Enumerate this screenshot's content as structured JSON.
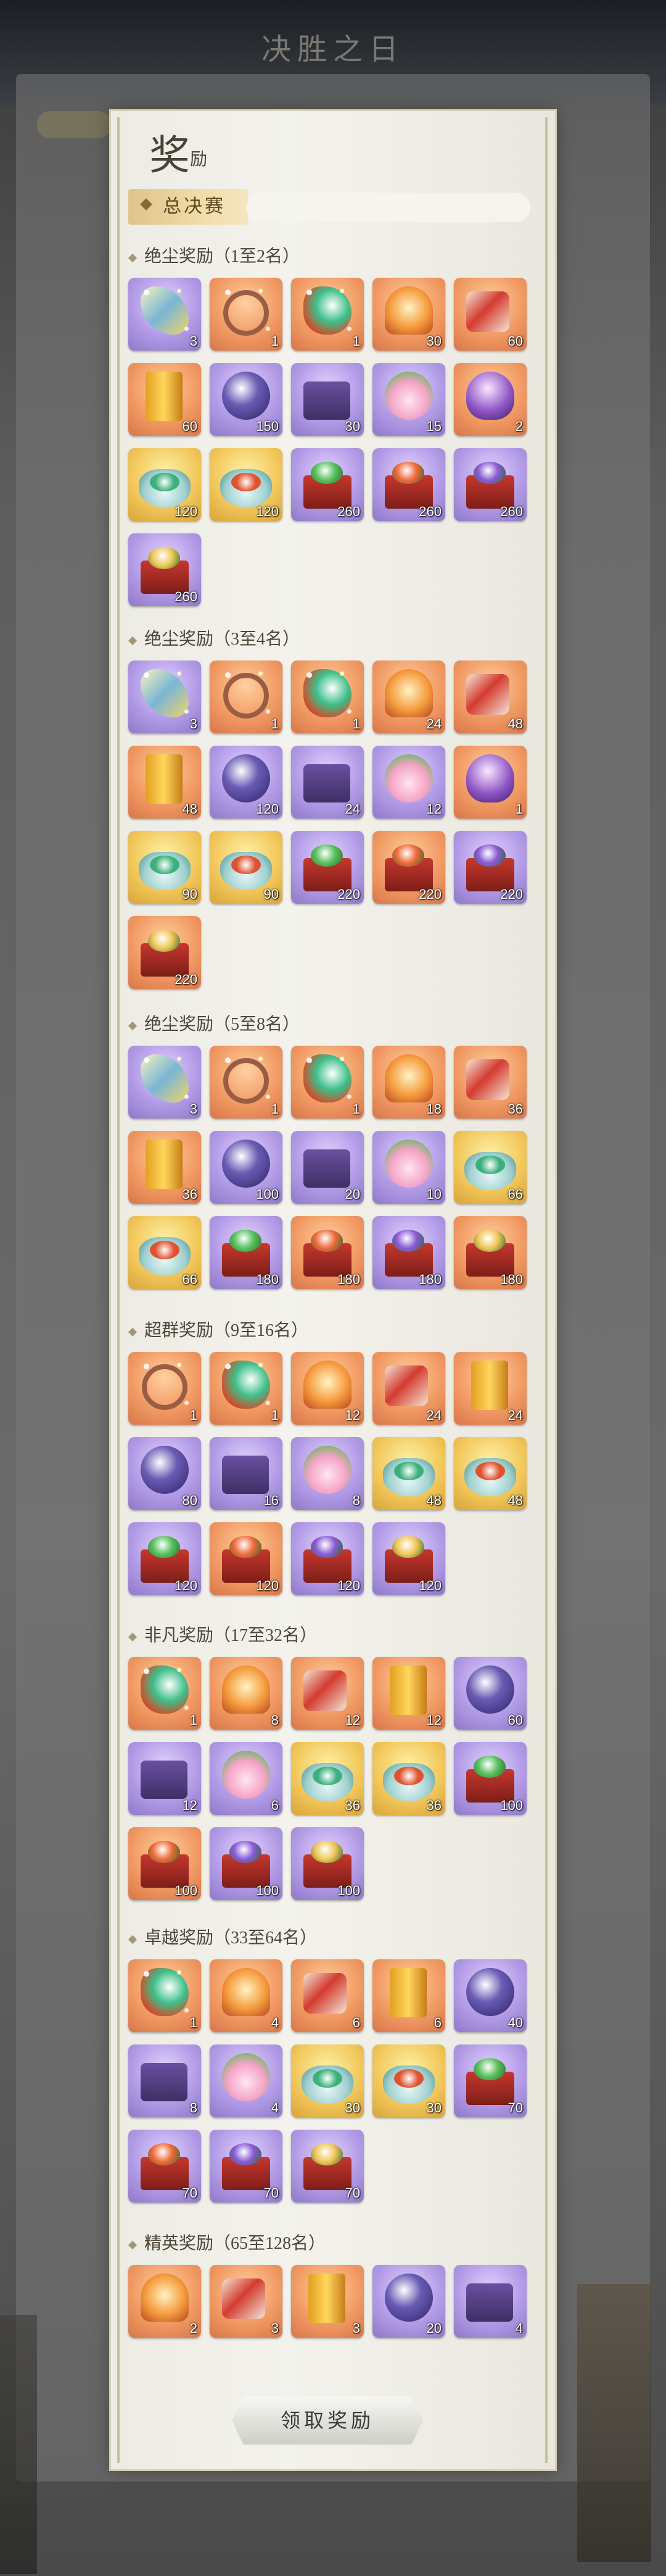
{
  "header": {
    "title": "决胜之日"
  },
  "panel": {
    "title_main": "奖",
    "title_sub": "励",
    "tab_label": "总决赛"
  },
  "sections": [
    {
      "title": "绝尘奖励（1至2名）",
      "items": [
        {
          "icon": "charm",
          "bg": "purple",
          "qty": "3",
          "sparkle": true
        },
        {
          "icon": "ring",
          "bg": "orange",
          "qty": "1",
          "sparkle": true
        },
        {
          "icon": "worm",
          "bg": "orange",
          "qty": "1",
          "sparkle": true
        },
        {
          "icon": "lamp",
          "bg": "orange",
          "qty": "30"
        },
        {
          "icon": "scroll",
          "bg": "orange",
          "qty": "60"
        },
        {
          "icon": "book",
          "bg": "orange",
          "qty": "60"
        },
        {
          "icon": "orb",
          "bg": "purple",
          "qty": "150"
        },
        {
          "icon": "box",
          "bg": "purple",
          "qty": "30"
        },
        {
          "icon": "lotus",
          "bg": "purple",
          "qty": "15"
        },
        {
          "icon": "vase",
          "bg": "orange",
          "qty": "2"
        },
        {
          "icon": "bowl-green",
          "bg": "gold",
          "qty": "120"
        },
        {
          "icon": "bowl-red",
          "bg": "gold",
          "qty": "120"
        },
        {
          "icon": "crate-green",
          "bg": "purple",
          "qty": "260"
        },
        {
          "icon": "crate-red",
          "bg": "purple",
          "qty": "260"
        },
        {
          "icon": "crate-purple",
          "bg": "purple",
          "qty": "260"
        },
        {
          "icon": "crate-gold",
          "bg": "purple",
          "qty": "260"
        }
      ]
    },
    {
      "title": "绝尘奖励（3至4名）",
      "items": [
        {
          "icon": "charm",
          "bg": "purple",
          "qty": "3",
          "sparkle": true
        },
        {
          "icon": "ring",
          "bg": "orange",
          "qty": "1",
          "sparkle": true
        },
        {
          "icon": "worm",
          "bg": "orange",
          "qty": "1",
          "sparkle": true
        },
        {
          "icon": "lamp",
          "bg": "orange",
          "qty": "24"
        },
        {
          "icon": "scroll",
          "bg": "orange",
          "qty": "48"
        },
        {
          "icon": "book",
          "bg": "orange",
          "qty": "48"
        },
        {
          "icon": "orb",
          "bg": "purple",
          "qty": "120"
        },
        {
          "icon": "box",
          "bg": "purple",
          "qty": "24"
        },
        {
          "icon": "lotus",
          "bg": "purple",
          "qty": "12"
        },
        {
          "icon": "vase",
          "bg": "orange",
          "qty": "1"
        },
        {
          "icon": "bowl-green",
          "bg": "gold",
          "qty": "90"
        },
        {
          "icon": "bowl-red",
          "bg": "gold",
          "qty": "90"
        },
        {
          "icon": "crate-green",
          "bg": "purple",
          "qty": "220"
        },
        {
          "icon": "crate-red",
          "bg": "orange",
          "qty": "220"
        },
        {
          "icon": "crate-purple",
          "bg": "purple",
          "qty": "220"
        },
        {
          "icon": "crate-gold",
          "bg": "orange",
          "qty": "220"
        }
      ]
    },
    {
      "title": "绝尘奖励（5至8名）",
      "items": [
        {
          "icon": "charm",
          "bg": "purple",
          "qty": "3",
          "sparkle": true
        },
        {
          "icon": "ring",
          "bg": "orange",
          "qty": "1",
          "sparkle": true
        },
        {
          "icon": "worm",
          "bg": "orange",
          "qty": "1",
          "sparkle": true
        },
        {
          "icon": "lamp",
          "bg": "orange",
          "qty": "18"
        },
        {
          "icon": "scroll",
          "bg": "orange",
          "qty": "36"
        },
        {
          "icon": "book",
          "bg": "orange",
          "qty": "36"
        },
        {
          "icon": "orb",
          "bg": "purple",
          "qty": "100"
        },
        {
          "icon": "box",
          "bg": "purple",
          "qty": "20"
        },
        {
          "icon": "lotus",
          "bg": "purple",
          "qty": "10"
        },
        {
          "icon": "bowl-green",
          "bg": "gold",
          "qty": "66"
        },
        {
          "icon": "bowl-red",
          "bg": "gold",
          "qty": "66"
        },
        {
          "icon": "crate-green",
          "bg": "purple",
          "qty": "180"
        },
        {
          "icon": "crate-red",
          "bg": "orange",
          "qty": "180"
        },
        {
          "icon": "crate-purple",
          "bg": "purple",
          "qty": "180"
        },
        {
          "icon": "crate-gold",
          "bg": "orange",
          "qty": "180"
        }
      ]
    },
    {
      "title": "超群奖励（9至16名）",
      "items": [
        {
          "icon": "ring",
          "bg": "orange",
          "qty": "1",
          "sparkle": true
        },
        {
          "icon": "worm",
          "bg": "orange",
          "qty": "1",
          "sparkle": true
        },
        {
          "icon": "lamp",
          "bg": "orange",
          "qty": "12"
        },
        {
          "icon": "scroll",
          "bg": "orange",
          "qty": "24"
        },
        {
          "icon": "book",
          "bg": "orange",
          "qty": "24"
        },
        {
          "icon": "orb",
          "bg": "purple",
          "qty": "80"
        },
        {
          "icon": "box",
          "bg": "purple",
          "qty": "16"
        },
        {
          "icon": "lotus",
          "bg": "purple",
          "qty": "8"
        },
        {
          "icon": "bowl-green",
          "bg": "gold",
          "qty": "48"
        },
        {
          "icon": "bowl-red",
          "bg": "gold",
          "qty": "48"
        },
        {
          "icon": "crate-green",
          "bg": "purple",
          "qty": "120"
        },
        {
          "icon": "crate-red",
          "bg": "orange",
          "qty": "120"
        },
        {
          "icon": "crate-purple",
          "bg": "purple",
          "qty": "120"
        },
        {
          "icon": "crate-gold",
          "bg": "purple",
          "qty": "120"
        }
      ]
    },
    {
      "title": "非凡奖励（17至32名）",
      "items": [
        {
          "icon": "worm",
          "bg": "orange",
          "qty": "1",
          "sparkle": true
        },
        {
          "icon": "lamp",
          "bg": "orange",
          "qty": "8"
        },
        {
          "icon": "scroll",
          "bg": "orange",
          "qty": "12"
        },
        {
          "icon": "book",
          "bg": "orange",
          "qty": "12"
        },
        {
          "icon": "orb",
          "bg": "purple",
          "qty": "60"
        },
        {
          "icon": "box",
          "bg": "purple",
          "qty": "12"
        },
        {
          "icon": "lotus",
          "bg": "purple",
          "qty": "6"
        },
        {
          "icon": "bowl-green",
          "bg": "gold",
          "qty": "36"
        },
        {
          "icon": "bowl-red",
          "bg": "gold",
          "qty": "36"
        },
        {
          "icon": "crate-green",
          "bg": "purple",
          "qty": "100"
        },
        {
          "icon": "crate-red",
          "bg": "orange",
          "qty": "100"
        },
        {
          "icon": "crate-purple",
          "bg": "purple",
          "qty": "100"
        },
        {
          "icon": "crate-gold",
          "bg": "purple",
          "qty": "100"
        }
      ]
    },
    {
      "title": "卓越奖励（33至64名）",
      "items": [
        {
          "icon": "worm",
          "bg": "orange",
          "qty": "1",
          "sparkle": true
        },
        {
          "icon": "lamp",
          "bg": "orange",
          "qty": "4"
        },
        {
          "icon": "scroll",
          "bg": "orange",
          "qty": "6"
        },
        {
          "icon": "book",
          "bg": "orange",
          "qty": "6"
        },
        {
          "icon": "orb",
          "bg": "purple",
          "qty": "40"
        },
        {
          "icon": "box",
          "bg": "purple",
          "qty": "8"
        },
        {
          "icon": "lotus",
          "bg": "purple",
          "qty": "4"
        },
        {
          "icon": "bowl-green",
          "bg": "gold",
          "qty": "30"
        },
        {
          "icon": "bowl-red",
          "bg": "gold",
          "qty": "30"
        },
        {
          "icon": "crate-green",
          "bg": "purple",
          "qty": "70"
        },
        {
          "icon": "crate-red",
          "bg": "purple",
          "qty": "70"
        },
        {
          "icon": "crate-purple",
          "bg": "purple",
          "qty": "70"
        },
        {
          "icon": "crate-gold",
          "bg": "purple",
          "qty": "70"
        }
      ]
    },
    {
      "title": "精英奖励（65至128名）",
      "items": [
        {
          "icon": "lamp",
          "bg": "orange",
          "qty": "2"
        },
        {
          "icon": "scroll",
          "bg": "orange",
          "qty": "3"
        },
        {
          "icon": "book",
          "bg": "orange",
          "qty": "3"
        },
        {
          "icon": "orb",
          "bg": "purple",
          "qty": "20"
        },
        {
          "icon": "box",
          "bg": "purple",
          "qty": "4"
        }
      ]
    }
  ],
  "claim_button_label": "领取奖励",
  "colors": {
    "orange_slot": "#f19a63",
    "purple_slot": "#b29be6",
    "gold_slot": "#f2c85c",
    "tab_gold": "#f3dfae"
  }
}
